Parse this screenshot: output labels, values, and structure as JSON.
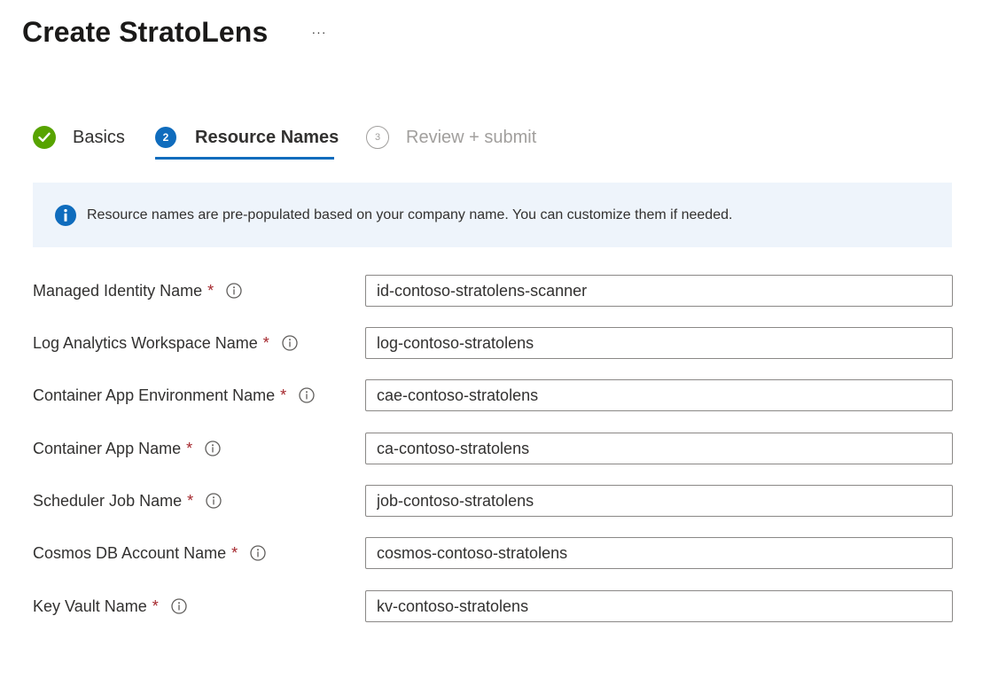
{
  "page": {
    "title": "Create StratoLens",
    "more_label": "···"
  },
  "wizard": {
    "steps": [
      {
        "number": "1",
        "label": "Basics",
        "status": "completed"
      },
      {
        "number": "2",
        "label": "Resource Names",
        "status": "current"
      },
      {
        "number": "3",
        "label": "Review + submit",
        "status": "pending"
      }
    ]
  },
  "banner": {
    "text": "Resource names are pre-populated based on your company name. You can customize them if needed.",
    "icon": "info-icon"
  },
  "form": {
    "required_marker": "*",
    "fields": [
      {
        "label": "Managed Identity Name",
        "value": "id-contoso-stratolens-scanner"
      },
      {
        "label": "Log Analytics Workspace Name",
        "value": "log-contoso-stratolens"
      },
      {
        "label": "Container App Environment Name",
        "value": "cae-contoso-stratolens"
      },
      {
        "label": "Container App Name",
        "value": "ca-contoso-stratolens"
      },
      {
        "label": "Scheduler Job Name",
        "value": "job-contoso-stratolens"
      },
      {
        "label": "Cosmos DB Account Name",
        "value": "cosmos-contoso-stratolens"
      },
      {
        "label": "Key Vault Name",
        "value": "kv-contoso-stratolens"
      }
    ]
  },
  "colors": {
    "accent": "#0f6cbd",
    "success": "#57a300",
    "required": "#a4262c",
    "banner_bg": "#eef4fb",
    "muted": "#a19f9d"
  }
}
